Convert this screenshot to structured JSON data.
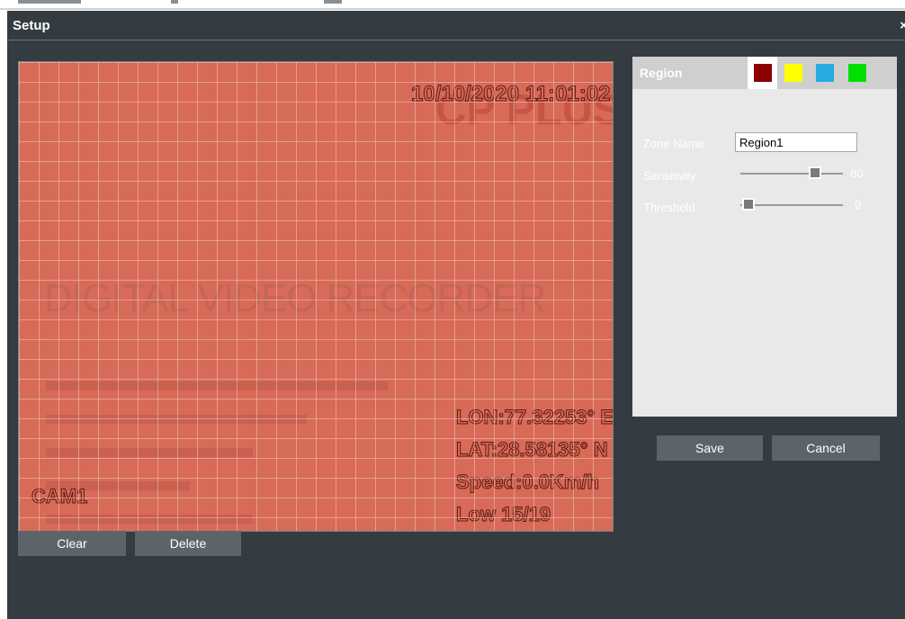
{
  "dialog": {
    "title": "Setup",
    "close_label": "×"
  },
  "video": {
    "timestamp": "10/10/2020 11:01:02",
    "brand": "CP PLUS",
    "banner": "DIGITAL VIDEO RECORDER",
    "camera": "CAM1",
    "gps": [
      "LON:77.32253° E",
      "LAT:28.58135° N",
      "Speed:0.0Km/h",
      "Low 15/19"
    ],
    "overlay_color": "#d86a58"
  },
  "buttons": {
    "clear": "Clear",
    "delete": "Delete",
    "save": "Save",
    "cancel": "Cancel"
  },
  "region_panel": {
    "title": "Region",
    "colors": [
      "#8b0000",
      "#ffff00",
      "#29abe2",
      "#00e000"
    ],
    "selected_color_index": 0,
    "zone_name_label": "Zone Name",
    "zone_name_value": "Region1",
    "sensitivity_label": "Sensitivity",
    "sensitivity_value": "80",
    "threshold_label": "Threshold",
    "threshold_value": "0"
  }
}
